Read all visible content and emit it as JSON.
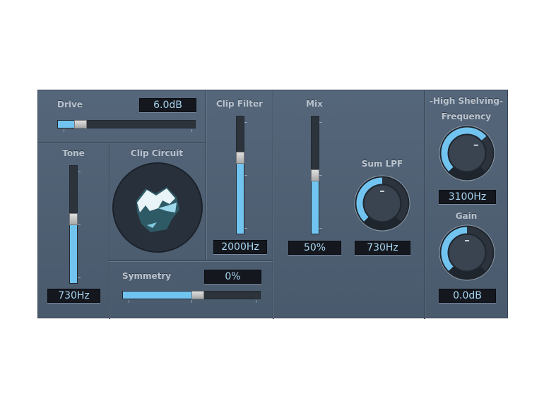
{
  "drive": {
    "label": "Drive",
    "value": "6.0dB",
    "fraction": 0.12
  },
  "tone": {
    "label": "Tone",
    "value": "730Hz",
    "fraction": 0.55
  },
  "clip_circuit": {
    "label": "Clip Circuit"
  },
  "clip_filter": {
    "label": "Clip Filter",
    "value": "2000Hz",
    "fraction": 0.65
  },
  "symmetry": {
    "label": "Symmetry",
    "value": "0%",
    "fraction": 0.5
  },
  "mix": {
    "label": "Mix",
    "value": "50%",
    "fraction": 0.5
  },
  "sum_lpf": {
    "label": "Sum LPF",
    "value": "730Hz",
    "fraction": 0.5
  },
  "high_shelving": {
    "label": "-High Shelving-",
    "frequency": {
      "label": "Frequency",
      "value": "3100Hz",
      "fraction": 0.68
    },
    "gain": {
      "label": "Gain",
      "value": "0.0dB",
      "fraction": 0.5
    }
  },
  "colors": {
    "accent": "#72c4f0",
    "panel": "#4e5e71"
  }
}
